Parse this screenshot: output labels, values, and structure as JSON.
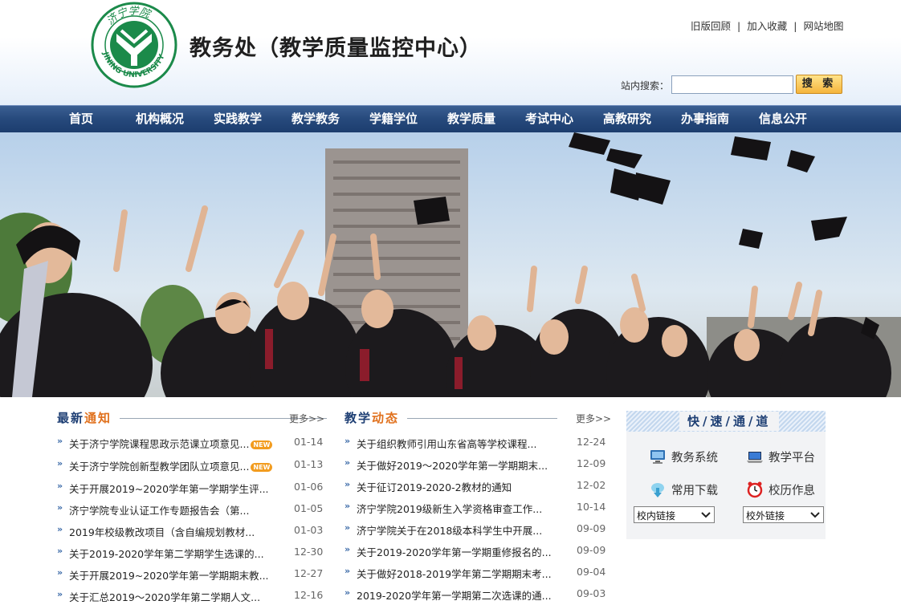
{
  "header": {
    "title": "教务处（教学质量监控中心）",
    "logo_text_top": "济宁学院",
    "logo_text_bottom": "JINING UNIVERSITY",
    "top_links": [
      "旧版回顾",
      "加入收藏",
      "网站地图"
    ],
    "search_label": "站内搜索：",
    "search_value": "",
    "search_button": "搜 索"
  },
  "nav": {
    "items": [
      "首页",
      "机构概况",
      "实践教学",
      "教学教务",
      "学籍学位",
      "教学质量",
      "考试中心",
      "高教研究",
      "办事指南",
      "信息公开"
    ]
  },
  "notice": {
    "title_part1": "最新",
    "title_part2": "通知",
    "more": "更多>>",
    "items": [
      {
        "title": "关于济宁学院课程思政示范课立项意见...",
        "date": "01-14",
        "badge": "NEW"
      },
      {
        "title": "关于济宁学院创新型教学团队立项意见...",
        "date": "01-13",
        "badge": "NEW"
      },
      {
        "title": "关于开展2019~2020学年第一学期学生评...",
        "date": "01-06",
        "badge": ""
      },
      {
        "title": "济宁学院专业认证工作专题报告会（第...",
        "date": "01-05",
        "badge": ""
      },
      {
        "title": "2019年校级教改项目（含自编规划教材...",
        "date": "01-03",
        "badge": ""
      },
      {
        "title": "关于2019-2020学年第二学期学生选课的...",
        "date": "12-30",
        "badge": ""
      },
      {
        "title": "关于开展2019~2020学年第一学期期末教...",
        "date": "12-27",
        "badge": ""
      },
      {
        "title": "关于汇总2019～2020学年第二学期人文...",
        "date": "12-16",
        "badge": ""
      }
    ]
  },
  "dynamics": {
    "title_part1": "教学",
    "title_part2": "动态",
    "more": "更多>>",
    "items": [
      {
        "title": "关于组织教师引用山东省高等学校课程...",
        "date": "12-24"
      },
      {
        "title": "关于做好2019～2020学年第一学期期末...",
        "date": "12-09"
      },
      {
        "title": "关于征订2019-2020-2教材的通知",
        "date": "12-02"
      },
      {
        "title": "济宁学院2019级新生入学资格审查工作...",
        "date": "10-14"
      },
      {
        "title": "济宁学院关于在2018级本科学生中开展...",
        "date": "09-09"
      },
      {
        "title": "关于2019-2020学年第一学期重修报名的...",
        "date": "09-09"
      },
      {
        "title": "关于做好2018-2019学年第二学期期末考...",
        "date": "09-04"
      },
      {
        "title": "2019-2020学年第一学期第二次选课的通...",
        "date": "09-03"
      }
    ]
  },
  "quick": {
    "title": "快/速/通/道",
    "links": [
      {
        "label": "教务系统",
        "icon": "monitor-icon"
      },
      {
        "label": "教学平台",
        "icon": "laptop-icon"
      },
      {
        "label": "常用下载",
        "icon": "download-icon"
      },
      {
        "label": "校历作息",
        "icon": "alarm-clock-icon"
      }
    ],
    "select_internal": "校内链接",
    "select_external": "校外链接"
  },
  "colors": {
    "nav_bg": "#26497c",
    "title_blue": "#1e3f74",
    "accent_orange": "#e0701c"
  }
}
